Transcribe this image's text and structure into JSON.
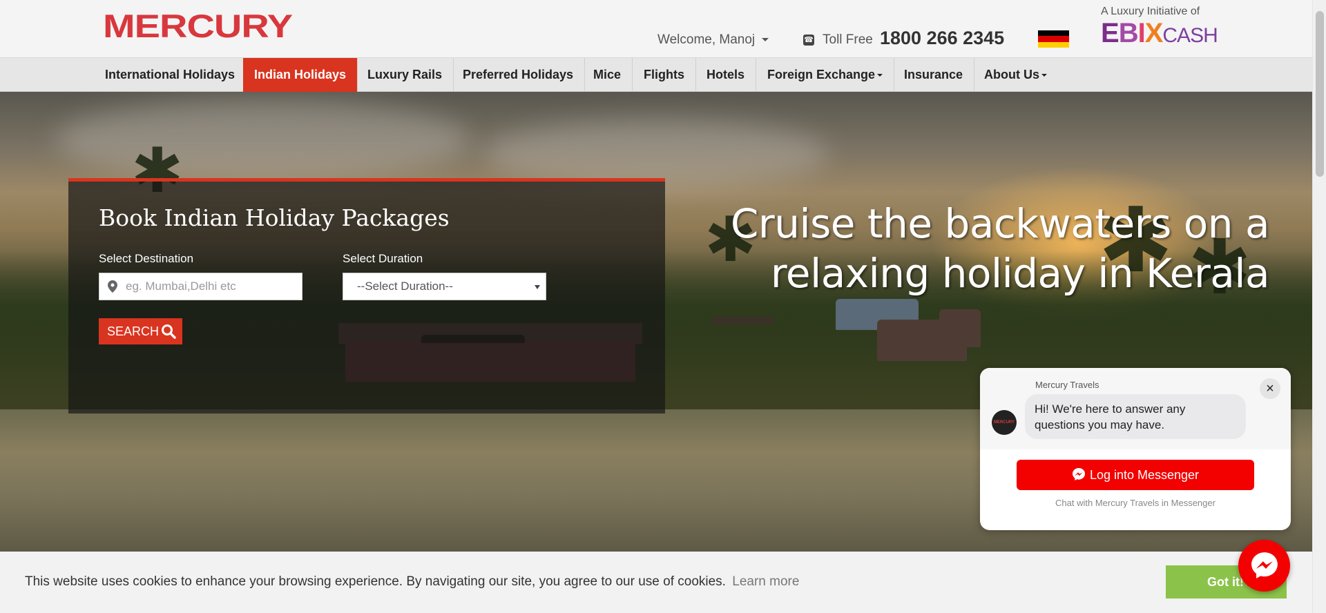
{
  "header": {
    "logo": "MERCURY",
    "welcome": "Welcome, Manoj",
    "toll_free_label": "Toll Free",
    "phone": "1800 266 2345",
    "initiative": "A Luxury Initiative of",
    "partner_logo": "EBIXCASH"
  },
  "nav": {
    "items": [
      {
        "label": "International Holidays"
      },
      {
        "label": "Indian Holidays",
        "active": true
      },
      {
        "label": "Luxury Rails"
      },
      {
        "label": "Preferred Holidays"
      },
      {
        "label": "Mice"
      },
      {
        "label": "Flights"
      },
      {
        "label": "Hotels"
      },
      {
        "label": "Foreign Exchange",
        "dropdown": true
      },
      {
        "label": "Insurance"
      },
      {
        "label": "About Us",
        "dropdown": true
      }
    ]
  },
  "hero": {
    "tagline_line1": "Cruise the backwaters on a",
    "tagline_line2": "relaxing holiday in Kerala"
  },
  "booking": {
    "title": "Book Indian Holiday Packages",
    "destination_label": "Select Destination",
    "destination_placeholder": "eg. Mumbai,Delhi etc",
    "duration_label": "Select Duration",
    "duration_selected": "--Select Duration--",
    "search_label": "SEARCH"
  },
  "chat": {
    "brand": "Mercury Travels",
    "avatar_text": "MERCURY",
    "message": "Hi! We're here to answer any questions you may have.",
    "close": "×",
    "login_label": "Log into Messenger",
    "footer": "Chat with Mercury Travels in Messenger"
  },
  "cookie": {
    "text": "This website uses cookies to enhance your browsing experience. By navigating our site, you agree to our use of cookies.",
    "link": "Learn more",
    "button": "Got it!"
  },
  "colors": {
    "brand_red": "#d8383d",
    "nav_active": "#d9341f",
    "messenger_red": "#f30000",
    "cookie_button": "#8bc34a"
  },
  "icons": [
    "phone-icon",
    "germany-flag-icon",
    "map-pin-icon",
    "search-icon",
    "close-icon",
    "messenger-icon"
  ]
}
